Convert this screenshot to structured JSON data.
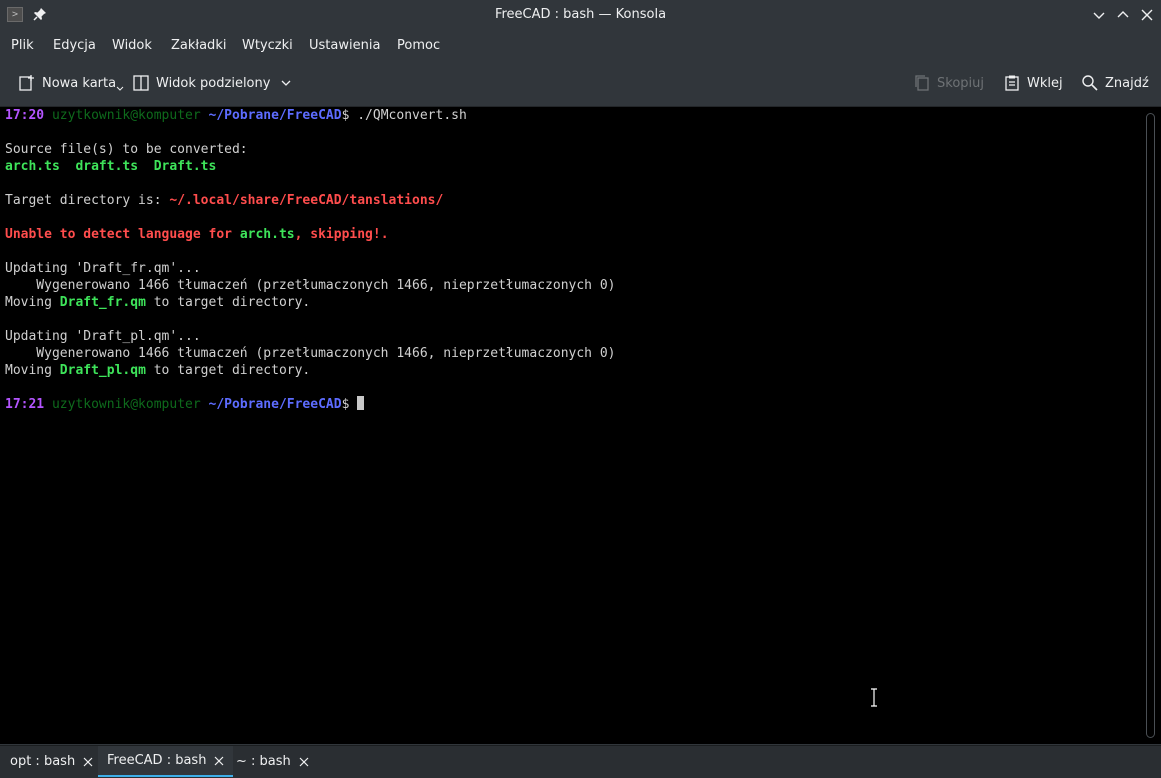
{
  "window": {
    "title": "FreeCAD : bash — Konsola",
    "app_icon_glyph": ">"
  },
  "menu": {
    "items": [
      "Plik",
      "Edycja",
      "Widok",
      "Zakładki",
      "Wtyczki",
      "Ustawienia",
      "Pomoc"
    ]
  },
  "toolbar": {
    "new_tab": "Nowa karta",
    "split_view": "Widok podzielony",
    "copy": "Skopiuj",
    "paste": "Wklej",
    "find": "Znajdź"
  },
  "terminal": {
    "l1_time": "17:20",
    "l1_host": " uzytkownik@komputer ",
    "l1_path": "~/Pobrane/FreeCAD",
    "l1_cmd": "$ ./QMconvert.sh",
    "l2": "Source file(s) to be converted:",
    "l3": "arch.ts  draft.ts  Draft.ts",
    "l4_a": "Target directory is: ",
    "l4_b": "~/.local/share/FreeCAD/tanslations/",
    "l5_a": "Unable to detect language for ",
    "l5_b": "arch.ts",
    "l5_c": ", skipping!.",
    "l6": "Updating 'Draft_fr.qm'...",
    "l7": "    Wygenerowano 1466 tłumaczeń (przetłumaczonych 1466, nieprzetłumaczonych 0)",
    "l8_a": "Moving ",
    "l8_b": "Draft_fr.qm",
    "l8_c": " to target directory.",
    "l9": "Updating 'Draft_pl.qm'...",
    "l10": "    Wygenerowano 1466 tłumaczeń (przetłumaczonych 1466, nieprzetłumaczonych 0)",
    "l11_a": "Moving ",
    "l11_b": "Draft_pl.qm",
    "l11_c": " to target directory.",
    "l12_time": "17:21",
    "l12_host": " uzytkownik@komputer ",
    "l12_path": "~/Pobrane/FreeCAD",
    "l12_prompt": "$ "
  },
  "tabs": [
    {
      "label": "opt : bash"
    },
    {
      "label": "FreeCAD : bash"
    },
    {
      "label": "~ : bash"
    }
  ],
  "colors": {
    "accent": "#3daee9",
    "prompt_time": "#b455ff",
    "prompt_path": "#5d6cff",
    "highlight_green": "#3ee45a",
    "error_red": "#ff4d4d"
  }
}
